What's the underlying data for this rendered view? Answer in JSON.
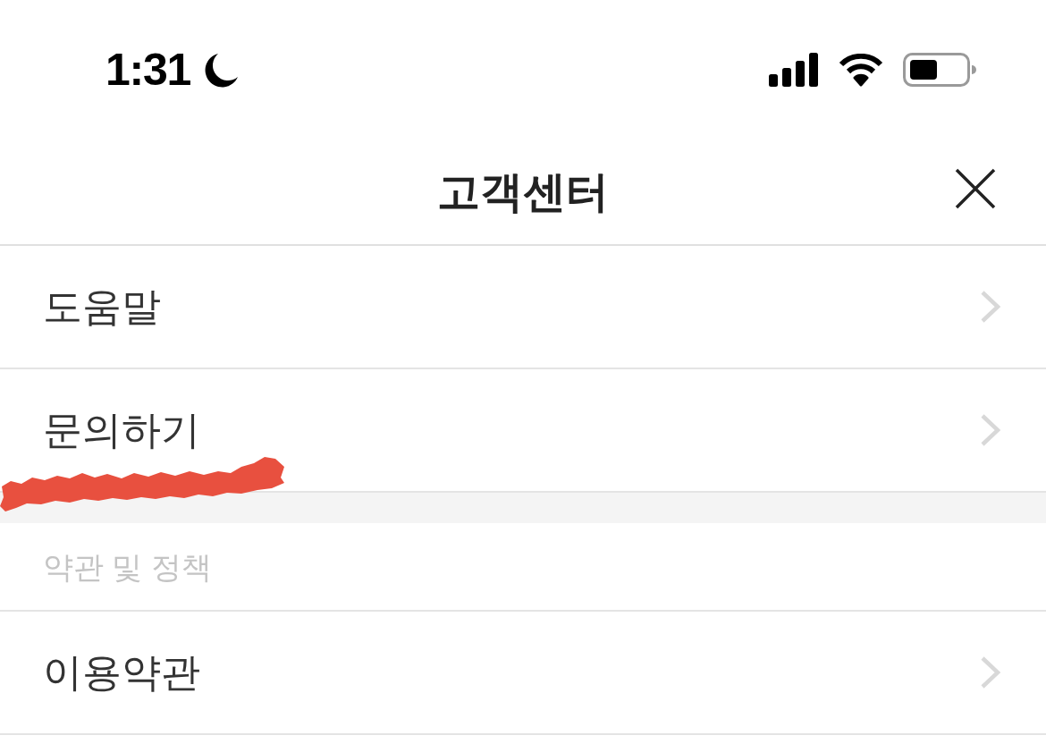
{
  "status_bar": {
    "time": "1:31"
  },
  "header": {
    "title": "고객센터"
  },
  "menu_items": [
    {
      "label": "도움말"
    },
    {
      "label": "문의하기"
    }
  ],
  "policy_section": {
    "title": "약관 및 정책",
    "items": [
      {
        "label": "이용약관"
      }
    ]
  }
}
